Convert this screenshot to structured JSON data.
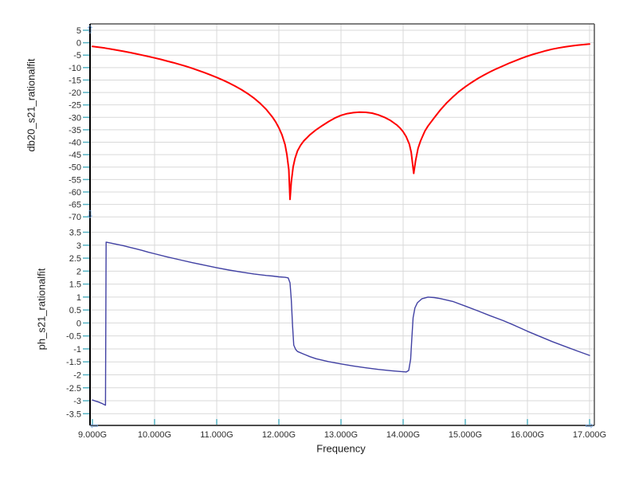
{
  "x_axis": {
    "label": "Frequency",
    "unit_suffix": "G",
    "lim": [
      9,
      17
    ],
    "tick_values": [
      9,
      10,
      11,
      12,
      13,
      14,
      15,
      16,
      17
    ],
    "tick_labels": [
      "9.000G",
      "10.000G",
      "11.000G",
      "12.000G",
      "13.000G",
      "14.000G",
      "15.000G",
      "16.000G",
      "17.000G"
    ]
  },
  "chart_data": [
    {
      "type": "line",
      "title": "",
      "ylabel": "db20_s21_rationalfit",
      "xlabel": "Frequency",
      "ylim": [
        -70,
        5
      ],
      "ytick_step": 5,
      "grid": true,
      "legend": "none",
      "y_tick_values": [
        5,
        0,
        -5,
        -10,
        -15,
        -20,
        -25,
        -30,
        -35,
        -40,
        -45,
        -50,
        -55,
        -60,
        -65,
        -70
      ],
      "y_tick_labels": [
        "5",
        "0",
        "-5",
        "-10",
        "-15",
        "-20",
        "-25",
        "-30",
        "-35",
        "-40",
        "-45",
        "-50",
        "-55",
        "-60",
        "-65",
        "-70"
      ],
      "series": [
        {
          "name": "db20_s21_rationalfit",
          "color": "#ff0000",
          "width": 2,
          "points": [
            [
              9,
              -1.5
            ],
            [
              9.1,
              -1.8
            ],
            [
              9.2,
              -2.15
            ],
            [
              9.3,
              -2.55
            ],
            [
              9.4,
              -3
            ],
            [
              9.5,
              -3.45
            ],
            [
              9.6,
              -3.95
            ],
            [
              9.7,
              -4.45
            ],
            [
              9.8,
              -5
            ],
            [
              9.9,
              -5.55
            ],
            [
              10,
              -6.1
            ],
            [
              10.1,
              -6.7
            ],
            [
              10.2,
              -7.35
            ],
            [
              10.3,
              -8
            ],
            [
              10.4,
              -8.7
            ],
            [
              10.5,
              -9.45
            ],
            [
              10.6,
              -10.25
            ],
            [
              10.7,
              -11.1
            ],
            [
              10.8,
              -12
            ],
            [
              10.9,
              -12.95
            ],
            [
              11,
              -13.95
            ],
            [
              11.1,
              -15.05
            ],
            [
              11.2,
              -16.2
            ],
            [
              11.3,
              -17.5
            ],
            [
              11.4,
              -18.9
            ],
            [
              11.5,
              -20.5
            ],
            [
              11.6,
              -22.3
            ],
            [
              11.7,
              -24.4
            ],
            [
              11.8,
              -26.9
            ],
            [
              11.9,
              -30
            ],
            [
              11.95,
              -31.9
            ],
            [
              12,
              -34.2
            ],
            [
              12.05,
              -37
            ],
            [
              12.1,
              -41
            ],
            [
              12.13,
              -45
            ],
            [
              12.16,
              -51
            ],
            [
              12.18,
              -63
            ],
            [
              12.2,
              -56
            ],
            [
              12.23,
              -50
            ],
            [
              12.26,
              -46.5
            ],
            [
              12.3,
              -43.5
            ],
            [
              12.35,
              -41.2
            ],
            [
              12.4,
              -39.5
            ],
            [
              12.5,
              -37
            ],
            [
              12.6,
              -35
            ],
            [
              12.7,
              -33.3
            ],
            [
              12.8,
              -31.7
            ],
            [
              12.9,
              -30.3
            ],
            [
              13,
              -29.2
            ],
            [
              13.1,
              -28.5
            ],
            [
              13.2,
              -28.1
            ],
            [
              13.3,
              -27.9
            ],
            [
              13.4,
              -28
            ],
            [
              13.5,
              -28.3
            ],
            [
              13.6,
              -29
            ],
            [
              13.7,
              -30
            ],
            [
              13.8,
              -31.3
            ],
            [
              13.9,
              -33.1
            ],
            [
              13.95,
              -34.3
            ],
            [
              14,
              -35.8
            ],
            [
              14.05,
              -37.8
            ],
            [
              14.1,
              -40.8
            ],
            [
              14.13,
              -44
            ],
            [
              14.17,
              -52.5
            ],
            [
              14.2,
              -47.5
            ],
            [
              14.24,
              -42.5
            ],
            [
              14.28,
              -39.5
            ],
            [
              14.35,
              -35.5
            ],
            [
              14.4,
              -33.5
            ],
            [
              14.5,
              -30.2
            ],
            [
              14.6,
              -27
            ],
            [
              14.7,
              -24.2
            ],
            [
              14.8,
              -21.8
            ],
            [
              14.9,
              -19.6
            ],
            [
              15,
              -17.7
            ],
            [
              15.1,
              -16
            ],
            [
              15.2,
              -14.4
            ],
            [
              15.3,
              -13
            ],
            [
              15.4,
              -11.7
            ],
            [
              15.5,
              -10.5
            ],
            [
              15.6,
              -9.4
            ],
            [
              15.7,
              -8.3
            ],
            [
              15.8,
              -7.3
            ],
            [
              15.9,
              -6.3
            ],
            [
              16,
              -5.4
            ],
            [
              16.1,
              -4.6
            ],
            [
              16.2,
              -3.9
            ],
            [
              16.3,
              -3.2
            ],
            [
              16.4,
              -2.6
            ],
            [
              16.5,
              -2.1
            ],
            [
              16.6,
              -1.7
            ],
            [
              16.7,
              -1.3
            ],
            [
              16.8,
              -1
            ],
            [
              16.9,
              -0.75
            ],
            [
              17,
              -0.55
            ]
          ]
        }
      ]
    },
    {
      "type": "line",
      "title": "",
      "ylabel": "ph_s21_rationalfit",
      "xlabel": "Frequency",
      "ylim": [
        -3.5,
        3.5
      ],
      "ytick_step": 0.5,
      "grid": true,
      "legend": "none",
      "y_tick_values": [
        3.5,
        3,
        2.5,
        2,
        1.5,
        1,
        0.5,
        0,
        -0.5,
        -1,
        -1.5,
        -2,
        -2.5,
        -3,
        -3.5
      ],
      "y_tick_labels": [
        "3.5",
        "3",
        "2.5",
        "2",
        "1.5",
        "1",
        "0.5",
        "0",
        "-0.5",
        "-1",
        "-1.5",
        "-2",
        "-2.5",
        "-3",
        "-3.5"
      ],
      "series": [
        {
          "name": "ph_s21_rationalfit",
          "color": "#4141a3",
          "width": 1.4,
          "points": [
            [
              9,
              -2.97
            ],
            [
              9.05,
              -3.01
            ],
            [
              9.1,
              -3.05
            ],
            [
              9.15,
              -3.1
            ],
            [
              9.19,
              -3.15
            ],
            [
              9.21,
              -3.17
            ],
            [
              9.22,
              3.12
            ],
            [
              9.3,
              3.08
            ],
            [
              9.4,
              3.03
            ],
            [
              9.5,
              2.98
            ],
            [
              9.6,
              2.92
            ],
            [
              9.7,
              2.86
            ],
            [
              9.8,
              2.8
            ],
            [
              9.9,
              2.73
            ],
            [
              10,
              2.67
            ],
            [
              10.2,
              2.55
            ],
            [
              10.4,
              2.44
            ],
            [
              10.6,
              2.33
            ],
            [
              10.8,
              2.23
            ],
            [
              11,
              2.13
            ],
            [
              11.2,
              2.04
            ],
            [
              11.4,
              1.96
            ],
            [
              11.6,
              1.89
            ],
            [
              11.8,
              1.83
            ],
            [
              11.9,
              1.81
            ],
            [
              12,
              1.78
            ],
            [
              12.1,
              1.76
            ],
            [
              12.15,
              1.74
            ],
            [
              12.18,
              1.55
            ],
            [
              12.2,
              0.9
            ],
            [
              12.22,
              -0.1
            ],
            [
              12.24,
              -0.85
            ],
            [
              12.27,
              -1.02
            ],
            [
              12.3,
              -1.1
            ],
            [
              12.4,
              -1.2
            ],
            [
              12.5,
              -1.3
            ],
            [
              12.6,
              -1.38
            ],
            [
              12.8,
              -1.49
            ],
            [
              13,
              -1.58
            ],
            [
              13.2,
              -1.66
            ],
            [
              13.4,
              -1.73
            ],
            [
              13.6,
              -1.79
            ],
            [
              13.8,
              -1.84
            ],
            [
              13.95,
              -1.87
            ],
            [
              14.05,
              -1.89
            ],
            [
              14.09,
              -1.83
            ],
            [
              14.12,
              -1.4
            ],
            [
              14.14,
              -0.6
            ],
            [
              14.16,
              0.2
            ],
            [
              14.19,
              0.58
            ],
            [
              14.23,
              0.78
            ],
            [
              14.3,
              0.93
            ],
            [
              14.4,
              1
            ],
            [
              14.5,
              0.98
            ],
            [
              14.6,
              0.94
            ],
            [
              14.8,
              0.83
            ],
            [
              15,
              0.65
            ],
            [
              15.2,
              0.47
            ],
            [
              15.4,
              0.28
            ],
            [
              15.6,
              0.1
            ],
            [
              15.8,
              -0.1
            ],
            [
              16,
              -0.32
            ],
            [
              16.2,
              -0.52
            ],
            [
              16.4,
              -0.72
            ],
            [
              16.6,
              -0.9
            ],
            [
              16.8,
              -1.08
            ],
            [
              17,
              -1.25
            ]
          ]
        }
      ]
    }
  ],
  "colors": {
    "background": "#ffffff",
    "grid": "#d9d9d9",
    "frame": "#555555",
    "y_axis_line": "#000000",
    "x_axis_line": "#4d4d4d",
    "tick_mark": "#56b2c2",
    "tick_label": "#2e2e2e",
    "trace_db20": "#ff0000",
    "trace_ph": "#4141a3",
    "axis_arrow": "#74a7e3"
  },
  "icons": {
    "up_arrow": "⇧",
    "down_arrow": "⇩",
    "left_arrow": "⇦",
    "right_arrow": "⇨"
  }
}
